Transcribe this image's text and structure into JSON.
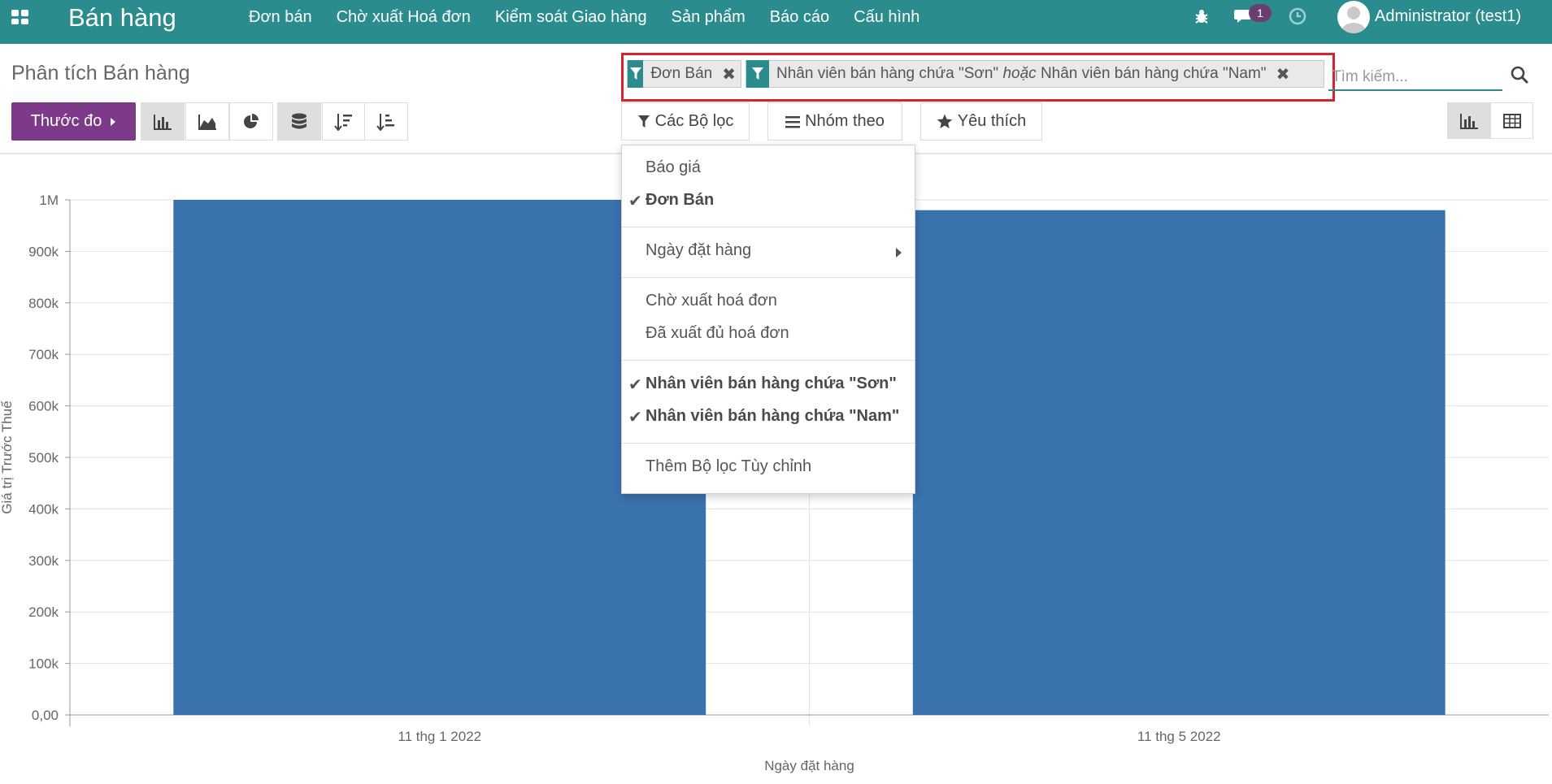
{
  "navbar": {
    "brand": "Bán hàng",
    "menu": [
      "Đơn bán",
      "Chờ xuất Hoá đơn",
      "Kiểm soát Giao hàng",
      "Sản phẩm",
      "Báo cáo",
      "Cấu hình"
    ],
    "chat_count": "1",
    "user": "Administrator (test1)",
    "color": "#2b8c8d"
  },
  "control_panel": {
    "title": "Phân tích Bán hàng",
    "facets": {
      "first": "Đơn Bán",
      "second_a": "Nhân viên bán hàng chứa \"Sơn\"",
      "second_or": "hoặc",
      "second_b": "Nhân viên bán hàng chứa \"Nam\""
    },
    "search_placeholder": "Tìm kiếm...",
    "measure_label": "Thước đo",
    "filters_label": "Các Bộ lọc",
    "groupby_label": "Nhóm theo",
    "favorites_label": "Yêu thích",
    "accent": "#7c3a88"
  },
  "filter_dropdown": {
    "items": [
      {
        "label": "Báo giá",
        "checked": false
      },
      {
        "label": "Đơn Bán",
        "checked": true
      },
      {
        "label": "Ngày đặt hàng",
        "checked": false
      },
      {
        "label": "Chờ xuất hoá đơn",
        "checked": false
      },
      {
        "label": "Đã xuất đủ hoá đơn",
        "checked": false
      },
      {
        "label": "Nhân viên bán hàng chứa \"Sơn\"",
        "checked": true
      },
      {
        "label": "Nhân viên bán hàng chứa \"Nam\"",
        "checked": true
      },
      {
        "label": "Thêm Bộ lọc Tùy chỉnh",
        "checked": false
      }
    ]
  },
  "chart_data": {
    "type": "bar",
    "categories": [
      "11 thg 1 2022",
      "11 thg 5 2022"
    ],
    "values": [
      1000000,
      980000
    ],
    "xlabel": "Ngày đặt hàng",
    "ylabel": "Giá trị Trước Thuế",
    "ylim": [
      0,
      1000000
    ],
    "yticks": [
      "0,00",
      "100k",
      "200k",
      "300k",
      "400k",
      "500k",
      "600k",
      "700k",
      "800k",
      "900k",
      "1M"
    ],
    "color": "#3a72ae",
    "grid": true
  }
}
